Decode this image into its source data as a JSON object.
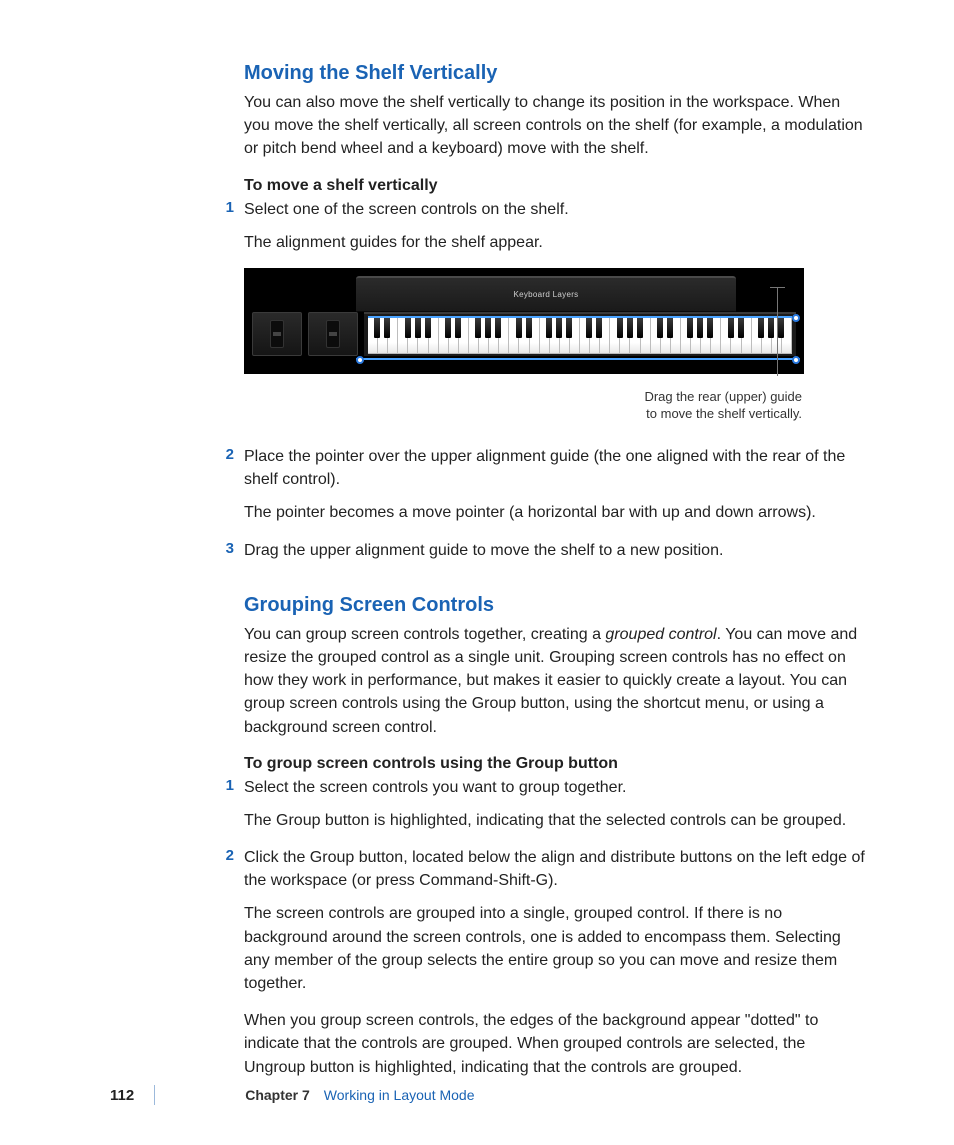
{
  "section1": {
    "heading": "Moving the Shelf Vertically",
    "intro": "You can also move the shelf vertically to change its position in the workspace. When you move the shelf vertically, all screen controls on the shelf (for example, a modulation or pitch bend wheel and a keyboard) move with the shelf.",
    "task_label": "To move a shelf vertically",
    "step1": "Select one of the screen controls on the shelf.",
    "step1_follow": "The alignment guides for the shelf appear.",
    "figure_label": "Keyboard Layers",
    "figure_caption": "Drag the rear (upper) guide to move the shelf vertically.",
    "step2": "Place the pointer over the upper alignment guide (the one aligned with the rear of the shelf control).",
    "step2_follow": "The pointer becomes a move pointer (a horizontal bar with up and down arrows).",
    "step3": "Drag the upper alignment guide to move the shelf to a new position."
  },
  "section2": {
    "heading": "Grouping Screen Controls",
    "intro_a": "You can group screen controls together, creating a ",
    "intro_em": "grouped control",
    "intro_b": ". You can move and resize the grouped control as a single unit. Grouping screen controls has no effect on how they work in performance, but makes it easier to quickly create a layout. You can group screen controls using the Group button, using the shortcut menu, or using a background screen control.",
    "task_label": "To group screen controls using the Group button",
    "step1": "Select the screen controls you want to group together.",
    "step1_follow": "The Group button is highlighted, indicating that the selected controls can be grouped.",
    "step2": "Click the Group button, located below the align and distribute buttons on the left edge of the workspace (or press Command-Shift-G).",
    "step2_follow1": "The screen controls are grouped into a single, grouped control. If there is no background around the screen controls, one is added to encompass them. Selecting any member of the group selects the entire group so you can move and resize them together.",
    "step2_follow2": "When you group screen controls, the edges of the background appear \"dotted\" to indicate that the controls are grouped. When grouped controls are selected, the Ungroup button is highlighted, indicating that the controls are grouped."
  },
  "footer": {
    "page": "112",
    "chapter_label": "Chapter 7",
    "chapter_title": "Working in Layout Mode"
  },
  "step_numbers": {
    "n1": "1",
    "n2": "2",
    "n3": "3"
  }
}
